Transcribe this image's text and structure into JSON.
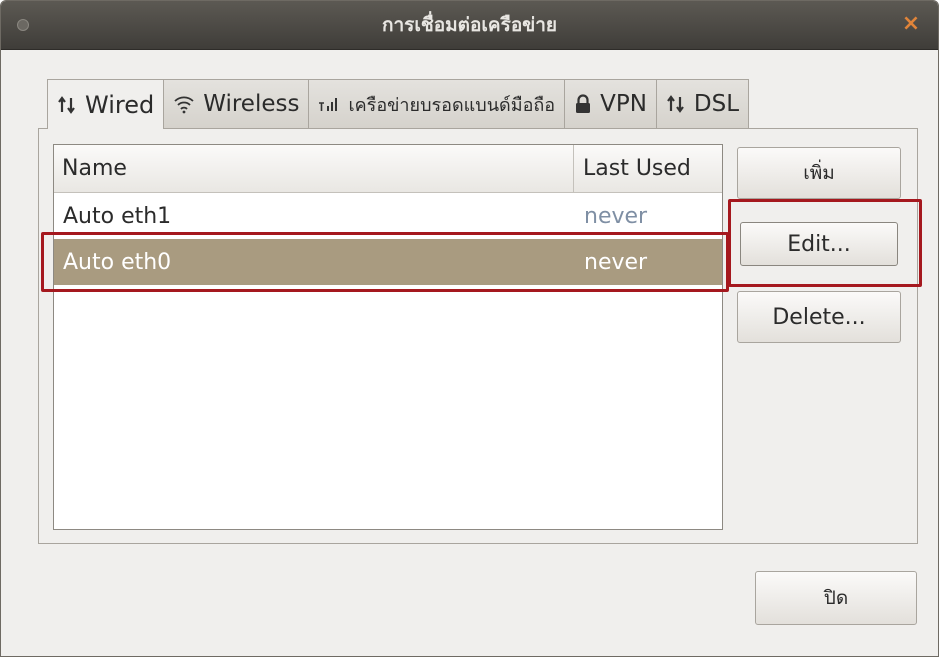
{
  "window": {
    "title": "การเชื่อมต่อเครือข่าย",
    "close_glyph": "×"
  },
  "tabs": [
    {
      "label": "Wired",
      "icon": "network-arrows-icon",
      "active": true
    },
    {
      "label": "Wireless",
      "icon": "wifi-icon",
      "active": false
    },
    {
      "label": "เครือข่ายบรอดแบนด์มือถือ",
      "icon": "signal-bars-icon",
      "active": false
    },
    {
      "label": "VPN",
      "icon": "lock-icon",
      "active": false
    },
    {
      "label": "DSL",
      "icon": "network-arrows-icon",
      "active": false
    }
  ],
  "list": {
    "columns": {
      "name": "Name",
      "last_used": "Last Used"
    },
    "rows": [
      {
        "name": "Auto eth1",
        "last_used": "never",
        "selected": false
      },
      {
        "name": "Auto eth0",
        "last_used": "never",
        "selected": true
      }
    ]
  },
  "buttons": {
    "add": "เพิ่ม",
    "edit": "Edit...",
    "delete": "Delete...",
    "close": "ปิด"
  },
  "colors": {
    "selection": "#a99b80",
    "highlight_box": "#a5181e",
    "close_icon": "#e0843a",
    "titlebar": "#4a4743"
  }
}
